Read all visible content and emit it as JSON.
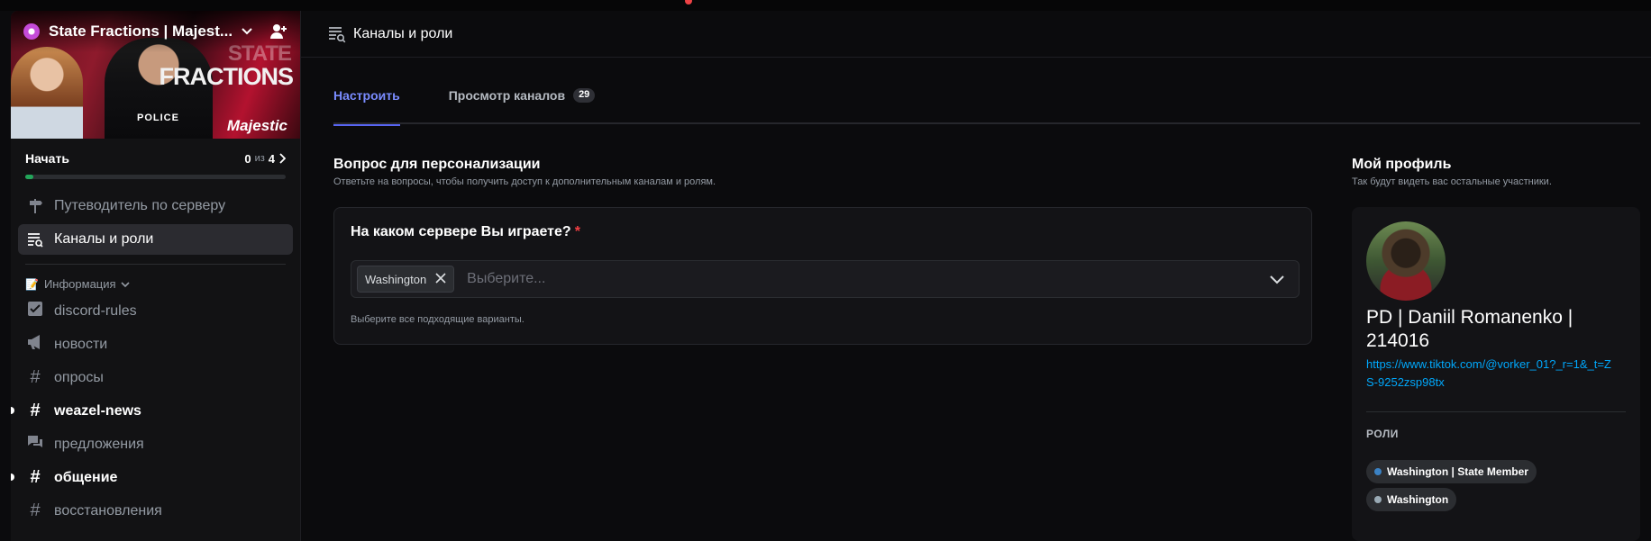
{
  "sidebar": {
    "server_name": "State Fractions | Majest...",
    "banner": {
      "state": "STATE",
      "fractions": "FRACTIONS",
      "police": "POLICE",
      "brand": "Majestic"
    },
    "progress": {
      "title": "Начать",
      "done": "0",
      "of": "из",
      "total": "4",
      "fraction": 0.03
    },
    "nav": [
      {
        "label": "Путеводитель по серверу",
        "icon": "signpost-icon"
      },
      {
        "label": "Каналы и роли",
        "icon": "channels-roles-icon"
      }
    ],
    "category": {
      "label": "Информация",
      "emoji": "📝"
    },
    "channels": [
      {
        "label": "discord-rules",
        "icon": "rules-icon",
        "unread": false
      },
      {
        "label": "новости",
        "icon": "megaphone-icon",
        "unread": false
      },
      {
        "label": "опросы",
        "icon": "hashtag-icon",
        "unread": false
      },
      {
        "label": "weazel-news",
        "icon": "hashtag-icon",
        "unread": true
      },
      {
        "label": "предложения",
        "icon": "forum-icon",
        "unread": false
      },
      {
        "label": "общение",
        "icon": "hashtag-icon",
        "unread": true
      },
      {
        "label": "восстановления",
        "icon": "hashtag-icon",
        "unread": false
      }
    ]
  },
  "header": {
    "title": "Каналы и роли"
  },
  "tabs": [
    {
      "label": "Настроить",
      "active": true
    },
    {
      "label": "Просмотр каналов",
      "count": "29",
      "active": false
    }
  ],
  "question_section": {
    "title": "Вопрос для персонализации",
    "subtitle": "Ответьте на вопросы, чтобы получить доступ к дополнительным каналам и ролям.",
    "question": "На каком сервере Вы играете?",
    "required_mark": "*",
    "selected_chip": "Washington",
    "placeholder": "Выберите...",
    "hint": "Выберите все подходящие варианты."
  },
  "profile_section": {
    "title": "Мой профиль",
    "subtitle": "Так будут видеть вас остальные участники.",
    "name": "PD | Daniil Romanenko | 214016",
    "link": "https://www.tiktok.com/@vorker_01?_r=1&_t=ZS-9252zsp98tx",
    "roles_title": "РОЛИ",
    "roles": [
      {
        "label": "Washington | State Member",
        "color": "#3b82c4"
      },
      {
        "label": "Washington",
        "color": "#99aab5"
      }
    ]
  },
  "colors": {
    "accent": "#5865f2",
    "unread_green": "#23a55a",
    "required_red": "#f23f43",
    "link_blue": "#00a8fc"
  }
}
